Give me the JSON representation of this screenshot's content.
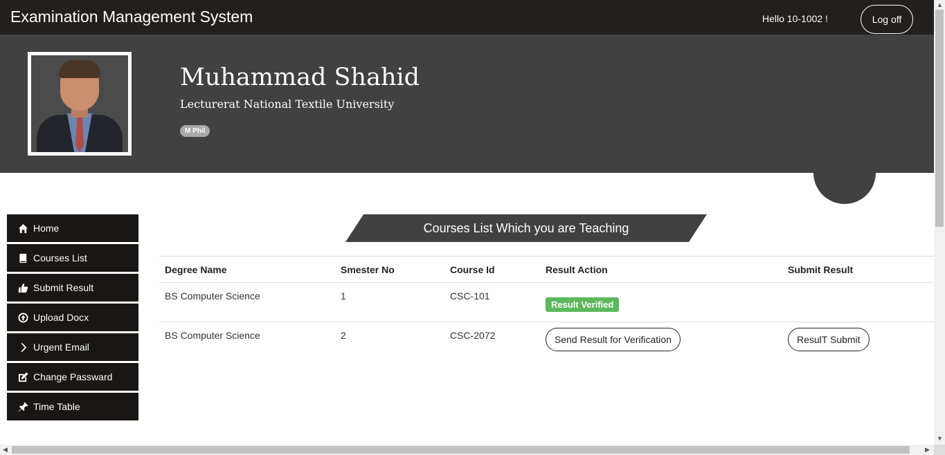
{
  "navbar": {
    "brand": "Examination Management System",
    "greeting": "Hello 10-1002 !",
    "logoff_label": "Log off"
  },
  "profile": {
    "name": "Muhammad Shahid",
    "title": "Lecturerat National Textile University",
    "badge": "M Phil"
  },
  "sidebar": {
    "items": [
      {
        "label": "Home",
        "icon": "home-icon"
      },
      {
        "label": "Courses List",
        "icon": "book-icon"
      },
      {
        "label": "Submit Result",
        "icon": "thumbs-up-icon"
      },
      {
        "label": "Upload Docx",
        "icon": "upload-icon"
      },
      {
        "label": "Urgent Email",
        "icon": "chevron-right-icon"
      },
      {
        "label": "Change Passward",
        "icon": "edit-icon"
      },
      {
        "label": "Time Table",
        "icon": "pushpin-icon"
      }
    ]
  },
  "main": {
    "banner": "Courses List Which you are Teaching",
    "table": {
      "headers": [
        "Degree Name",
        "Smester No",
        "Course Id",
        "Result Action",
        "Submit Result"
      ],
      "rows": [
        {
          "degree": "BS Computer Science",
          "semester": "1",
          "course_id": "CSC-101",
          "result_action": "Result Verified",
          "submit": ""
        },
        {
          "degree": "BS Computer Science",
          "semester": "2",
          "course_id": "CSC-2072",
          "result_action": "Send Result for Verification",
          "submit": "ResulT Submit"
        }
      ]
    }
  },
  "colors": {
    "navbar": "#231f1e",
    "profile_bg": "#414141",
    "sidebar_bg": "#191615",
    "verified": "#5cb85c"
  }
}
